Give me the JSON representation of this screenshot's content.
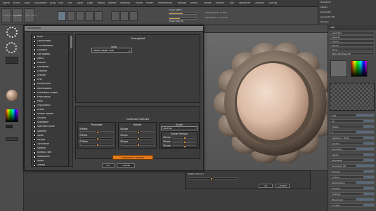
{
  "menubar": {
    "items": [
      "Alpha",
      "Brush",
      "Color",
      "Document",
      "Draw",
      "Edit",
      "File",
      "Layer",
      "Light",
      "Macro",
      "Marker",
      "Material",
      "Movie",
      "Picker",
      "Preferences",
      "Render",
      "Stencil",
      "Stroke",
      "Texture",
      "Tool",
      "Transform",
      "Zplugin",
      "Zscript"
    ],
    "active_points": "ActivePoints: 11.633",
    "total_points": "TotalPoints: 1.413 Mil",
    "focal_shift": "Focal Shift 0",
    "draw_size": "Draw Size 64"
  },
  "toolbar": {
    "projection_master": "Projection Master",
    "lightbox": "LightBox",
    "quick_sketch": "Quick Sketch"
  },
  "right_top": {
    "items": [
      "Transform",
      "Layers",
      "Geometry",
      "Geometry HD",
      "Preview"
    ]
  },
  "right_panel": {
    "header": "Tool",
    "rows": [
      "Load Tool",
      "Save As",
      "Import",
      "Export",
      "Clone",
      "Make PolyMesh3D",
      "GoZ",
      "All",
      "Visible",
      "R",
      "Lightbox > Tools",
      "Subtool",
      "Geometry",
      "Layers",
      "FiberMesh",
      "Geometry HD",
      "Preview",
      "Surface",
      "Deformation",
      "Masking",
      "Visibility",
      "Polygroups",
      "Contact",
      "Morph Target"
    ]
  },
  "dialog": {
    "title": "NoiseMaker",
    "noise_list": [
      "Brick",
      "Camouflage",
      "Checkerboard",
      "Chestnut",
      "Corrugated",
      "Dents",
      "Erosion",
      "Fibrillation",
      "Gradient",
      "Granite",
      "Grid",
      "Honeycomb",
      "Houndstooth",
      "Perforated Shapes",
      "Perlin Noise",
      "Plaid",
      "Psychedelic",
      "Scales",
      "Simple Marble",
      "Sinuses",
      "Snakeskin",
      "Speckled Stone",
      "Spheres",
      "Spiral",
      "Stripes",
      "Turbulence",
      "Voronoi",
      "Voronoi Tiles",
      "Waveforms",
      "Wood",
      "Zigzag"
    ],
    "noise_selected_index": 4,
    "top_section_title": "Corrugated",
    "style_label": "Style",
    "style_value": "Wave Shape: Sine",
    "common_controls_title": "Common Controls",
    "translate_title": "Translate",
    "translate_labels": [
      "XOffset",
      "YOffset",
      "ZOffset"
    ],
    "rotate_title": "Rotate",
    "rotate_labels": [
      "XAngle",
      "YAngle",
      "ZAngle"
    ],
    "scale_title": "Scale",
    "scale_value": "18.6951",
    "scale_factors_title": "Scale Factors",
    "scale_factor_labels": [
      "XScale",
      "YScale",
      "ZScale"
    ],
    "interactive_update": "Interactive Update",
    "ok": "OK",
    "cancel": "Cancel"
  },
  "bottom_dialog": {
    "label": "Alpha: Sec207",
    "ok": "OK",
    "cancel": "Cancel"
  },
  "colors": {
    "accent": "#e27a1c",
    "slider_fill": "#c8a04a",
    "panel_bg": "#414141"
  }
}
